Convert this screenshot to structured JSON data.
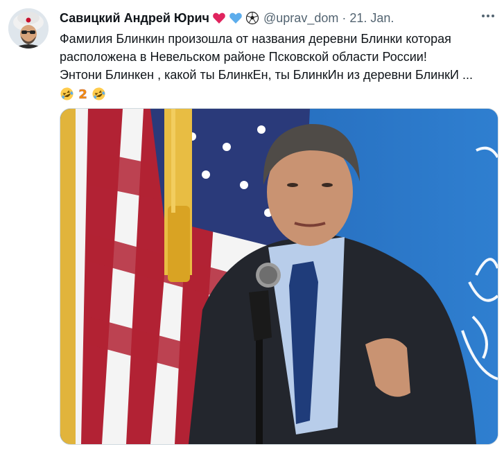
{
  "tweet": {
    "author_name": "Савицкий Андрей Юрич",
    "handle": "@uprav_dom",
    "separator": "·",
    "timestamp": "21. Jan.",
    "name_emojis": [
      "red-heart",
      "blue-heart",
      "soccer-ball"
    ],
    "text_lines": [
      "Фамилия Блинкин произошла от названия деревни Блинки которая",
      "расположена в  Невельском районе Псковской области России!",
      "Энтони Блинкен , какой ты БлинкЕн, ты БлинкИн из деревни БлинкИ ..."
    ],
    "trailing_emojis": [
      "rofl",
      "number-2",
      "rofl"
    ],
    "media": {
      "type": "photo",
      "description_icon": "photo-icon"
    }
  },
  "colors": {
    "text": "#0f1419",
    "secondary": "#536471",
    "heart_red": "#e0245e",
    "heart_blue": "#5dadec",
    "media_bg": "#2a6fc0"
  }
}
